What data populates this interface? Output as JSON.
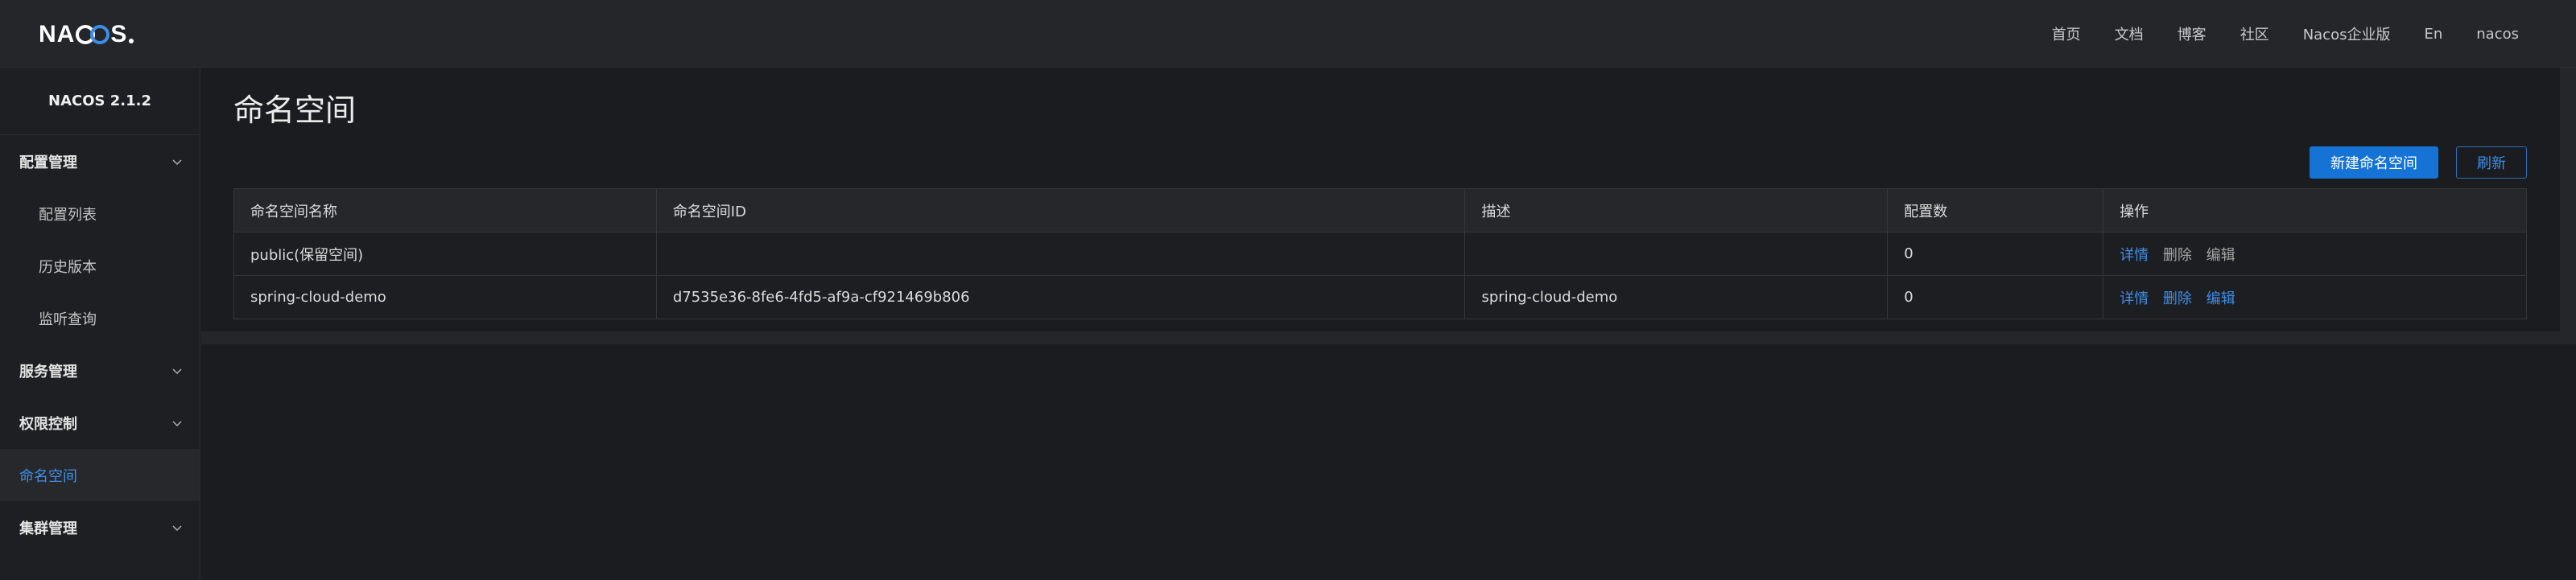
{
  "header": {
    "logo_text": "NACOS.",
    "nav": [
      "首页",
      "文档",
      "博客",
      "社区",
      "Nacos企业版",
      "En",
      "nacos"
    ]
  },
  "sidebar": {
    "version": "NACOS 2.1.2",
    "items": [
      {
        "label": "配置管理",
        "type": "group",
        "expanded": true
      },
      {
        "label": "配置列表",
        "type": "sub"
      },
      {
        "label": "历史版本",
        "type": "sub"
      },
      {
        "label": "监听查询",
        "type": "sub"
      },
      {
        "label": "服务管理",
        "type": "group"
      },
      {
        "label": "权限控制",
        "type": "group"
      },
      {
        "label": "命名空间",
        "type": "group",
        "active": true
      },
      {
        "label": "集群管理",
        "type": "group"
      }
    ]
  },
  "main": {
    "title": "命名空间",
    "buttons": {
      "create": "新建命名空间",
      "refresh": "刷新"
    },
    "table": {
      "columns": [
        "命名空间名称",
        "命名空间ID",
        "描述",
        "配置数",
        "操作"
      ],
      "rows": [
        {
          "name": "public(保留空间)",
          "id": "",
          "desc": "",
          "count": "0",
          "ops": [
            "详情",
            "删除",
            "编辑"
          ]
        },
        {
          "name": "spring-cloud-demo",
          "id": "d7535e36-8fe6-4fd5-af9a-cf921469b806",
          "desc": "spring-cloud-demo",
          "count": "0",
          "ops": [
            "详情",
            "删除",
            "编辑"
          ]
        }
      ]
    }
  },
  "colors": {
    "accent": "#3e8ee8",
    "primary_button": "#1673d6",
    "background": "#1b1c1f",
    "header": "#25262a"
  }
}
